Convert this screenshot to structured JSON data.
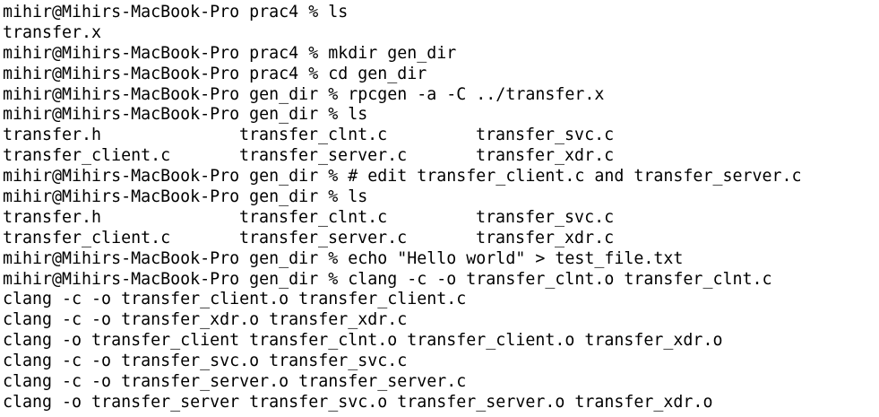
{
  "terminal": {
    "lines": [
      "mihir@Mihirs-MacBook-Pro prac4 % ls",
      "transfer.x",
      "mihir@Mihirs-MacBook-Pro prac4 % mkdir gen_dir",
      "mihir@Mihirs-MacBook-Pro prac4 % cd gen_dir",
      "mihir@Mihirs-MacBook-Pro gen_dir % rpcgen -a -C ../transfer.x",
      "mihir@Mihirs-MacBook-Pro gen_dir % ls"
    ],
    "ls1": [
      [
        "transfer.h",
        "transfer_clnt.c",
        "transfer_svc.c"
      ],
      [
        "transfer_client.c",
        "transfer_server.c",
        "transfer_xdr.c"
      ]
    ],
    "lines2": [
      "mihir@Mihirs-MacBook-Pro gen_dir % # edit transfer_client.c and transfer_server.c",
      "mihir@Mihirs-MacBook-Pro gen_dir % ls"
    ],
    "ls2": [
      [
        "transfer.h",
        "transfer_clnt.c",
        "transfer_svc.c"
      ],
      [
        "transfer_client.c",
        "transfer_server.c",
        "transfer_xdr.c"
      ]
    ],
    "lines3": [
      "mihir@Mihirs-MacBook-Pro gen_dir % echo \"Hello world\" > test_file.txt",
      "mihir@Mihirs-MacBook-Pro gen_dir % clang -c -o transfer_clnt.o transfer_clnt.c",
      "clang -c -o transfer_client.o transfer_client.c",
      "clang -c -o transfer_xdr.o transfer_xdr.c",
      "clang -o transfer_client transfer_clnt.o transfer_client.o transfer_xdr.o",
      "clang -c -o transfer_svc.o transfer_svc.c",
      "clang -c -o transfer_server.o transfer_server.c",
      "clang -o transfer_server transfer_svc.o transfer_server.o transfer_xdr.o"
    ]
  }
}
